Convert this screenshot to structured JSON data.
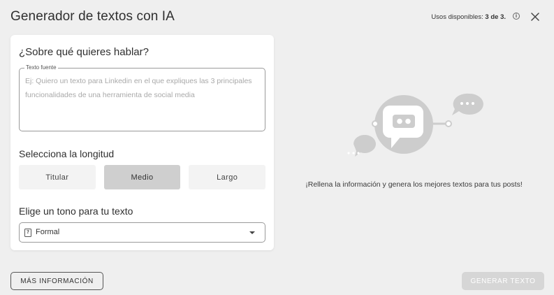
{
  "header": {
    "title": "Generador de textos con IA",
    "usage_label": "Usos disponibles:",
    "usage_count": "3 de 3."
  },
  "form": {
    "topic_question": "¿Sobre qué quieres hablar?",
    "source_label": "Texto fuente",
    "source_placeholder": "Ej: Quiero un texto para Linkedin en el que expliques las 3 principales funcionalidades de una herramienta de social media",
    "length_question": "Selecciona la longitud",
    "length_options": [
      {
        "label": "Titular"
      },
      {
        "label": "Medio"
      },
      {
        "label": "Largo"
      }
    ],
    "length_selected": "Medio",
    "tone_question": "Elige un tono para tu texto",
    "tone_selected": "Formal"
  },
  "right_panel": {
    "message": "¡Rellena la información y genera los mejores textos para tus posts!"
  },
  "footer": {
    "more_info_label": "MÁS INFORMACIÓN",
    "generate_label": "GENERAR TEXTO"
  },
  "colors": {
    "background": "#efefef",
    "card": "#ffffff",
    "selected_option": "#cfcfcf",
    "disabled_button": "#d6d6d6",
    "illustration": "#cdcdcd"
  },
  "icons": {
    "info": "info-icon",
    "close": "close-icon",
    "tone": "question-square-icon",
    "dropdown": "caret-down-icon",
    "illustration": "robot-chat-icon"
  }
}
